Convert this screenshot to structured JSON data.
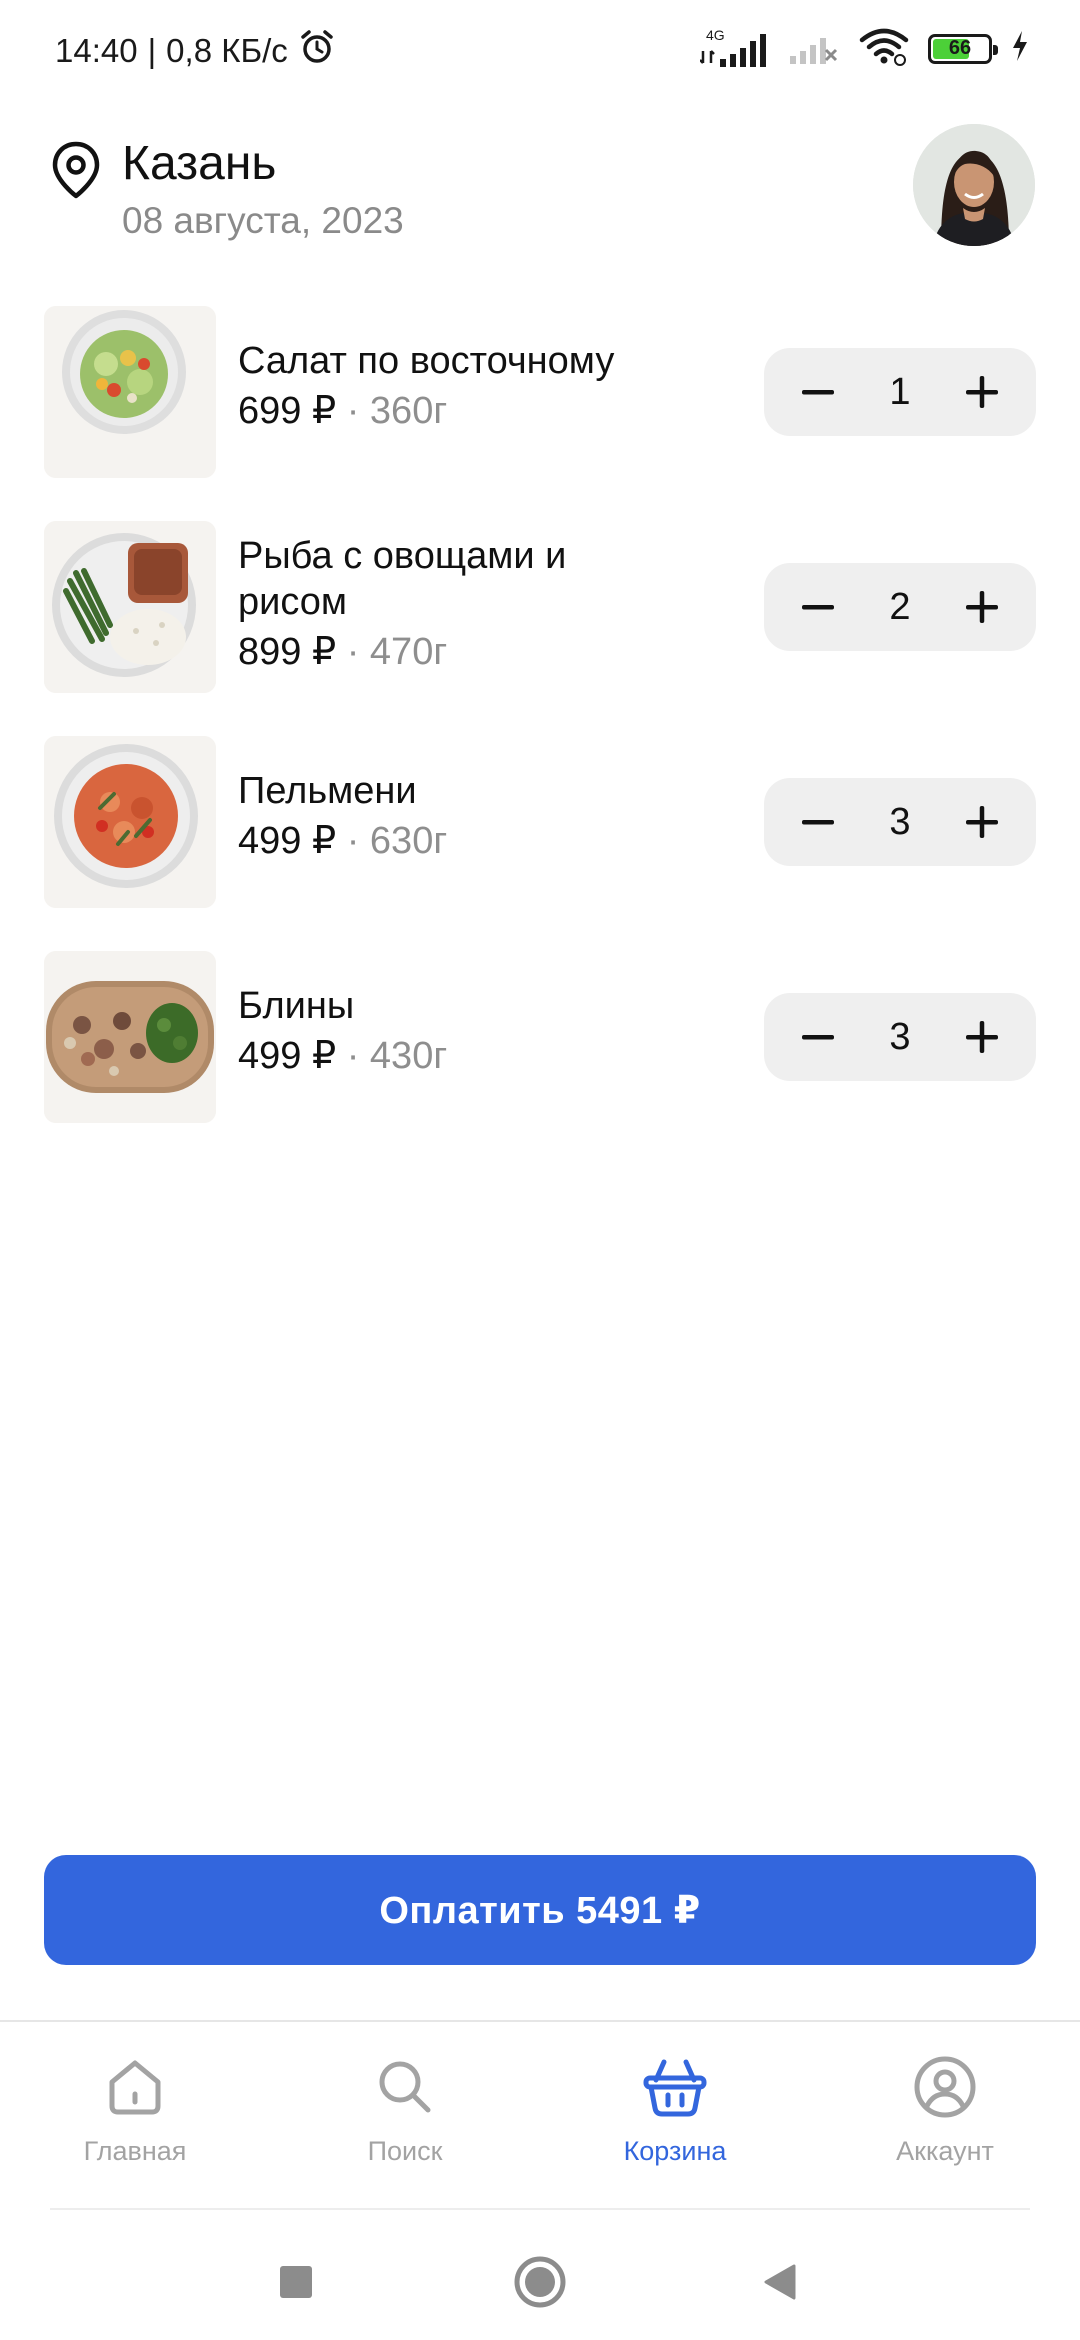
{
  "status_bar": {
    "time": "14:40",
    "speed": "0,8 КБ/с",
    "network_type": "4G",
    "battery_level": "66",
    "battery_percent": 66,
    "icons": [
      "alarm-icon",
      "signal-icon",
      "signal-off-icon",
      "wifi-icon",
      "battery-icon",
      "charging-icon"
    ]
  },
  "header": {
    "city": "Казань",
    "date": "08 августа, 2023",
    "icons": [
      "location-pin-icon",
      "avatar"
    ]
  },
  "cart": {
    "items": [
      {
        "name": "Салат по восточному",
        "price": "699 ₽",
        "separator": "·",
        "weight": "360г",
        "quantity": "1"
      },
      {
        "name": "Рыба с овощами и рисом",
        "price": "899 ₽",
        "separator": "·",
        "weight": "470г",
        "quantity": "2"
      },
      {
        "name": "Пельмени",
        "price": "499 ₽",
        "separator": "·",
        "weight": "630г",
        "quantity": "3"
      },
      {
        "name": "Блины",
        "price": "499 ₽",
        "separator": "·",
        "weight": "430г",
        "quantity": "3"
      }
    ]
  },
  "pay_button": {
    "label": "Оплатить 5491 ₽"
  },
  "bottom_nav": {
    "active": "cart",
    "items": [
      {
        "id": "home",
        "label": "Главная",
        "icon": "home-icon"
      },
      {
        "id": "search",
        "label": "Поиск",
        "icon": "search-icon"
      },
      {
        "id": "cart",
        "label": "Корзина",
        "icon": "basket-icon"
      },
      {
        "id": "account",
        "label": "Аккаунт",
        "icon": "user-icon"
      }
    ]
  },
  "colors": {
    "accent": "#3366dd",
    "stepper_bg": "#efefef",
    "muted_text": "#8e8e8e",
    "nav_inactive": "#a3a3a3",
    "battery_fill": "#4cd038"
  }
}
